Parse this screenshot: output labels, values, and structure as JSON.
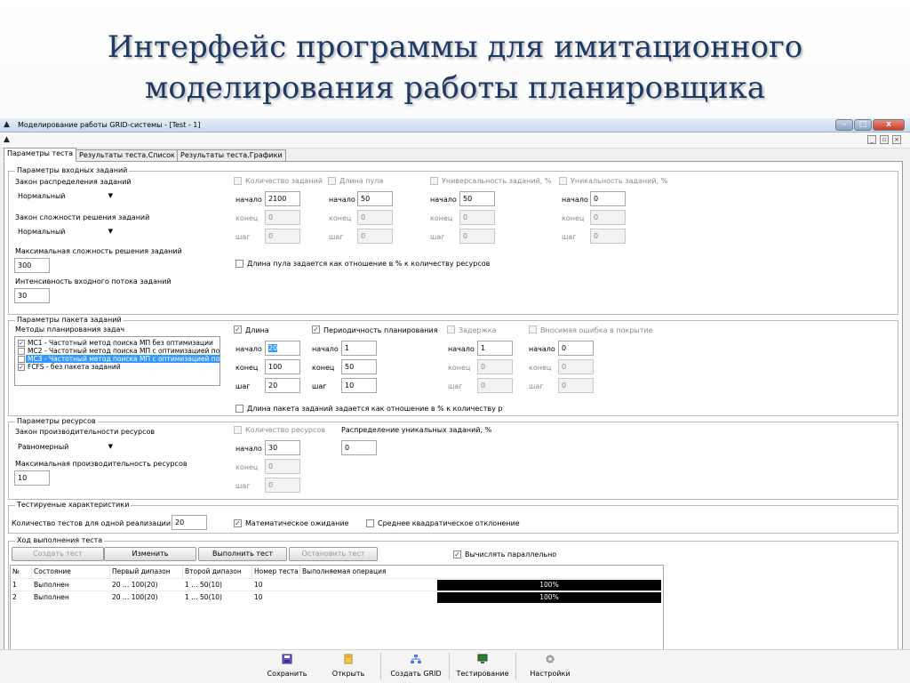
{
  "slide": {
    "title_line1": "Интерфейс программы для имитационного",
    "title_line2": "моделирования работы планировщика"
  },
  "window": {
    "title": "Моделирование работы GRID-системы - [Test - 1]",
    "min": "–",
    "max": "□",
    "close": "x",
    "mdi_min": "_",
    "mdi_restore": "▫",
    "mdi_close": "×"
  },
  "tabs": [
    "Параметры теста",
    "Результаты теста.Список",
    "Результаты теста.Графики"
  ],
  "input_group": {
    "title": "Параметры входных заданий",
    "dist_law_label": "Закон распределения заданий",
    "dist_law_value": "Нормальный",
    "complexity_law_label": "Закон сложности решения заданий",
    "complexity_law_value": "Нормальный",
    "max_complexity_label": "Максимальная сложность решения заданий",
    "max_complexity_value": "300",
    "intensity_label": "Интенсивность входного потока заданий",
    "intensity_value": "30",
    "columns": [
      {
        "title": "Количество заданий",
        "checked": false,
        "start": "2100",
        "end": "0",
        "step": "0"
      },
      {
        "title": "Длина пула",
        "checked": false,
        "start": "50",
        "end": "0",
        "step": "0"
      },
      {
        "title": "Универсальность заданий, %",
        "checked": false,
        "start": "50",
        "end": "0",
        "step": "0"
      },
      {
        "title": "Уникальность заданий, %",
        "checked": false,
        "start": "0",
        "end": "0",
        "step": "0"
      }
    ],
    "pool_ratio_label": "Длина пула задается как отношение в % к количеству ресурсов"
  },
  "labels": {
    "start": "начало",
    "end": "конец",
    "step": "шаг"
  },
  "packet_group": {
    "title": "Параметры пакета заданий",
    "methods_label": "Методы планирования задач",
    "methods": [
      {
        "label": "МС1 - Частотный метод поиска МП без оптимизации",
        "checked": true
      },
      {
        "label": "МС2 - Частотный метод поиска МП с оптимизацией по",
        "checked": false
      },
      {
        "label": "МС3 - Частотный метод поиска МП с оптимизацией по",
        "checked": false
      },
      {
        "label": "FCFS - без пакета заданий",
        "checked": true
      }
    ],
    "columns": [
      {
        "title": "Длина",
        "checked": true,
        "start": "20",
        "end": "100",
        "step": "20"
      },
      {
        "title": "Периодичность планирования",
        "checked": true,
        "start": "1",
        "end": "50",
        "step": "10"
      },
      {
        "title": "Задержка",
        "checked": false,
        "start": "1",
        "end": "0",
        "step": "0"
      },
      {
        "title": "Вносимая ошибка в покрытие",
        "checked": false,
        "start": "0",
        "end": "0",
        "step": "0"
      }
    ],
    "ratio_label": "Длина пакета заданий задается как отношение в % к количеству р"
  },
  "resource_group": {
    "title": "Параметры ресурсов",
    "perf_law_label": "Закон производительности ресурсов",
    "perf_law_value": "Равномерный",
    "max_perf_label": "Максимальная производительность ресурсов",
    "max_perf_value": "10",
    "count_label": "Количество ресурсов",
    "count_start": "30",
    "count_end": "0",
    "count_step": "0",
    "unique_label": "Распределение уникальных заданий, %",
    "unique_value": "0"
  },
  "tested_group": {
    "title": "Тестируеные характеристики",
    "tests_label": "Количество тестов для одной реализации",
    "tests_value": "20",
    "mean_label": "Математическое ожидание",
    "mean_checked": true,
    "std_label": "Среднее квадратическое отклонение",
    "std_checked": false
  },
  "progress_group": {
    "title": "Ход выполнения теста",
    "create_btn": "Создать тест",
    "edit_btn": "Изменить",
    "run_btn": "Выполнить тест",
    "stop_btn": "Остановить тест",
    "parallel_label": "Вычислять параллельно",
    "parallel_checked": true,
    "columns": [
      "№",
      "Состояние",
      "Первый дипазон",
      "Второй дипазон",
      "Номер теста",
      "Выполняемая операция"
    ],
    "rows": [
      {
        "n": "1",
        "state": "Выполнен",
        "r1": "20 … 100(20)",
        "r2": "1 … 50(10)",
        "test": "10",
        "progress": 1.0,
        "progress_label": "100%"
      },
      {
        "n": "2",
        "state": "Выполнен",
        "r1": "20 … 100(20)",
        "r2": "1 … 50(10)",
        "test": "10",
        "progress": 1.0,
        "progress_label": "100%"
      }
    ]
  },
  "toolbar": [
    {
      "label": "Сохранить",
      "icon": "save-icon"
    },
    {
      "label": "Открыть",
      "icon": "open-icon"
    },
    {
      "label": "Создать GRID",
      "icon": "grid-network-icon"
    },
    {
      "label": "Тестирование",
      "icon": "monitor-icon"
    },
    {
      "label": "Настройки",
      "icon": "gear-icon"
    }
  ],
  "colors": {
    "title_blue": "#1f3864",
    "selection": "#3399ff",
    "progress": "#000000"
  }
}
